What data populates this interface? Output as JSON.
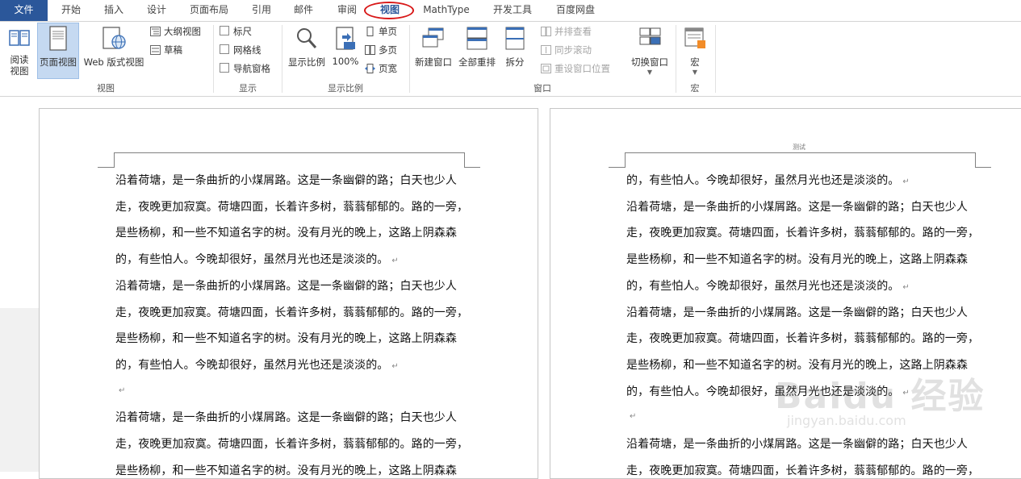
{
  "tabs": {
    "file": "文件",
    "home": "开始",
    "insert": "插入",
    "design": "设计",
    "layout": "页面布局",
    "refs": "引用",
    "mail": "邮件",
    "review": "审阅",
    "view": "视图",
    "mathtype": "MathType",
    "dev": "开发工具",
    "baidu": "百度网盘"
  },
  "ribbon": {
    "views": {
      "read_mode": [
        "阅读",
        "视图"
      ],
      "print_layout": "页面视图",
      "web_layout": "Web 版式视图",
      "outline": "大纲视图",
      "draft": "草稿",
      "label": "视图"
    },
    "show": {
      "ruler": "标尺",
      "gridlines": "网格线",
      "nav_pane": "导航窗格",
      "label": "显示"
    },
    "zoom": {
      "zoom": "显示比例",
      "hundred": "100%",
      "one_page": "单页",
      "multi_page": "多页",
      "page_width": "页宽",
      "label": "显示比例"
    },
    "window": {
      "new_window": "新建窗口",
      "arrange_all": "全部重排",
      "split": "拆分",
      "side_by_side": "并排查看",
      "sync_scroll": "同步滚动",
      "reset_pos": "重设窗口位置",
      "switch_windows": "切换窗口",
      "label": "窗口"
    },
    "macros": {
      "macros": "宏",
      "label": "宏"
    }
  },
  "document": {
    "header_right": "测试",
    "left_page_lines": [
      "沿着荷塘，是一条曲折的小煤屑路。这是一条幽僻的路；白天也少人",
      "走，夜晚更加寂寞。荷塘四面，长着许多树，蓊蓊郁郁的。路的一旁，",
      "是些杨柳，和一些不知道名字的树。没有月光的晚上，这路上阴森森",
      "的，有些怕人。今晚却很好，虽然月光也还是淡淡的。",
      "沿着荷塘，是一条曲折的小煤屑路。这是一条幽僻的路；白天也少人",
      "走，夜晚更加寂寞。荷塘四面，长着许多树，蓊蓊郁郁的。路的一旁，",
      "是些杨柳，和一些不知道名字的树。没有月光的晚上，这路上阴森森",
      "的，有些怕人。今晚却很好，虽然月光也还是淡淡的。",
      "",
      "沿着荷塘，是一条曲折的小煤屑路。这是一条幽僻的路；白天也少人",
      "走，夜晚更加寂寞。荷塘四面，长着许多树，蓊蓊郁郁的。路的一旁，",
      "是些杨柳，和一些不知道名字的树。没有月光的晚上，这路上阴森森"
    ],
    "right_page_lines": [
      "的，有些怕人。今晚却很好，虽然月光也还是淡淡的。",
      "沿着荷塘，是一条曲折的小煤屑路。这是一条幽僻的路；白天也少人",
      "走，夜晚更加寂寞。荷塘四面，长着许多树，蓊蓊郁郁的。路的一旁，",
      "是些杨柳，和一些不知道名字的树。没有月光的晚上，这路上阴森森",
      "的，有些怕人。今晚却很好，虽然月光也还是淡淡的。",
      "沿着荷塘，是一条曲折的小煤屑路。这是一条幽僻的路；白天也少人",
      "走，夜晚更加寂寞。荷塘四面，长着许多树，蓊蓊郁郁的。路的一旁，",
      "是些杨柳，和一些不知道名字的树。没有月光的晚上，这路上阴森森",
      "的，有些怕人。今晚却很好，虽然月光也还是淡淡的。",
      "",
      "沿着荷塘，是一条曲折的小煤屑路。这是一条幽僻的路；白天也少人",
      "走，夜晚更加寂寞。荷塘四面，长着许多树，蓊蓊郁郁的。路的一旁，"
    ],
    "para_end_after": [
      3,
      7,
      8
    ],
    "right_para_end_after": [
      0,
      4,
      8,
      9
    ]
  },
  "watermark": {
    "text": "Baidu 经验",
    "sub": "jingyan.baidu.com"
  },
  "colors": {
    "file_tab": "#2b579a",
    "highlight_ring": "#d81818",
    "selected_view_btn": "#c5d9f1"
  }
}
